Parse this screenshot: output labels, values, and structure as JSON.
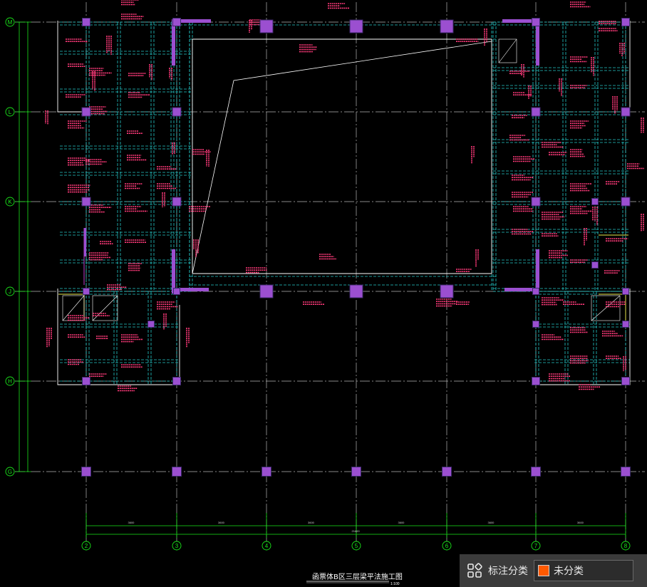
{
  "drawing": {
    "title": "函票体B区三层梁平法施工图",
    "scale": "1:100",
    "row_axes": [
      "M",
      "L",
      "K",
      "J",
      "H",
      "G"
    ],
    "col_axes": [
      "2",
      "3",
      "4",
      "5",
      "6",
      "7",
      "8"
    ],
    "dims_bottom": [
      "3600",
      "3600",
      "3600",
      "3600",
      "3600",
      "3600"
    ],
    "dim_total": "21600",
    "colors": {
      "background": "#000000",
      "axis": "#19e619",
      "grid": "#b4b4b4",
      "beam": "#24c8c8",
      "column": "#9b4fd0",
      "annotation": "#ff3a7a",
      "outline": "#ffffff",
      "highlight": "#e6e64c"
    }
  },
  "panel": {
    "category_icon": "category-grid-icon",
    "category_label": "标注分类",
    "layer_label": "未分类",
    "layer_color": "#ff5a00"
  }
}
